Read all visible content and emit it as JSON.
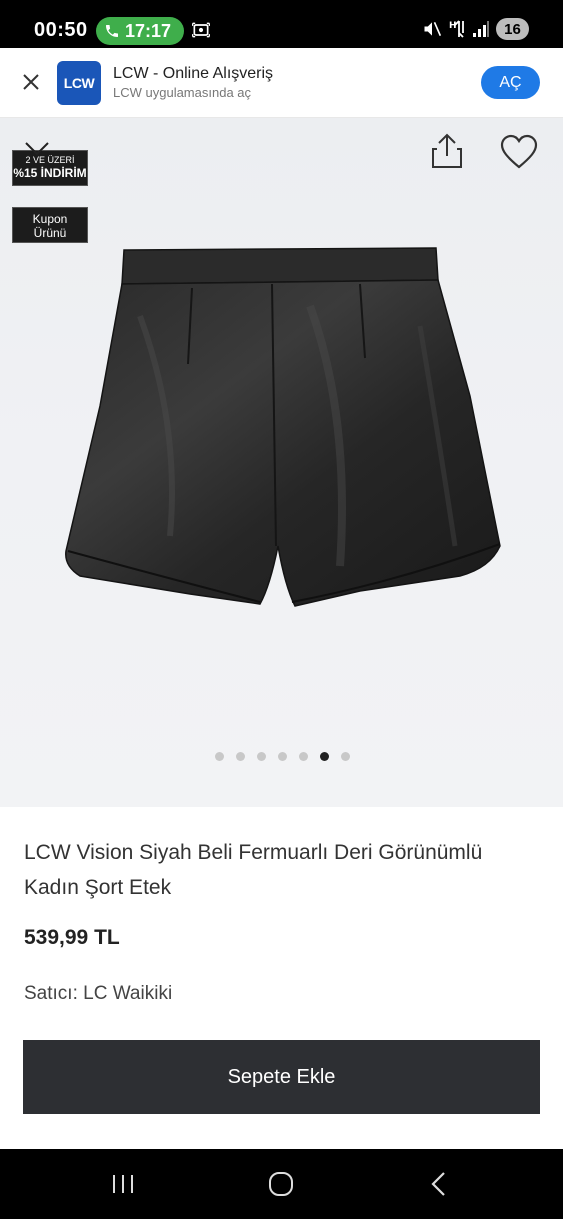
{
  "status_bar": {
    "time": "00:50",
    "call_timer": "17:17",
    "battery": "16"
  },
  "app_banner": {
    "logo_text": "LCW",
    "app_name": "LCW - Online Alışveriş",
    "app_subtitle": "LCW uygulamasında aç",
    "open_label": "AÇ"
  },
  "product": {
    "badges": {
      "discount_line1": "2 VE ÜZERİ",
      "discount_line2": "%15 İNDİRİM",
      "coupon_line1": "Kupon",
      "coupon_line2": "Ürünü"
    },
    "carousel": {
      "count": 7,
      "active_index": 5
    },
    "title": "LCW Vision Siyah Beli Fermuarlı Deri Görünümlü Kadın Şort Etek",
    "price": "539,99 TL",
    "seller": "Satıcı: LC Waikiki",
    "add_to_cart_label": "Sepete Ekle"
  },
  "icons": {
    "call": "phone-icon",
    "screen_record": "screen-record-icon",
    "close": "close-icon",
    "share": "share-icon",
    "favorite": "heart-icon",
    "nav_recents": "recents-icon",
    "nav_home": "home-icon",
    "nav_back": "back-icon"
  },
  "colors": {
    "call_pill": "#3fae4b",
    "open_button": "#1f7ae6",
    "logo_bg": "#1a56b8",
    "cart_button": "#2d2f33"
  }
}
